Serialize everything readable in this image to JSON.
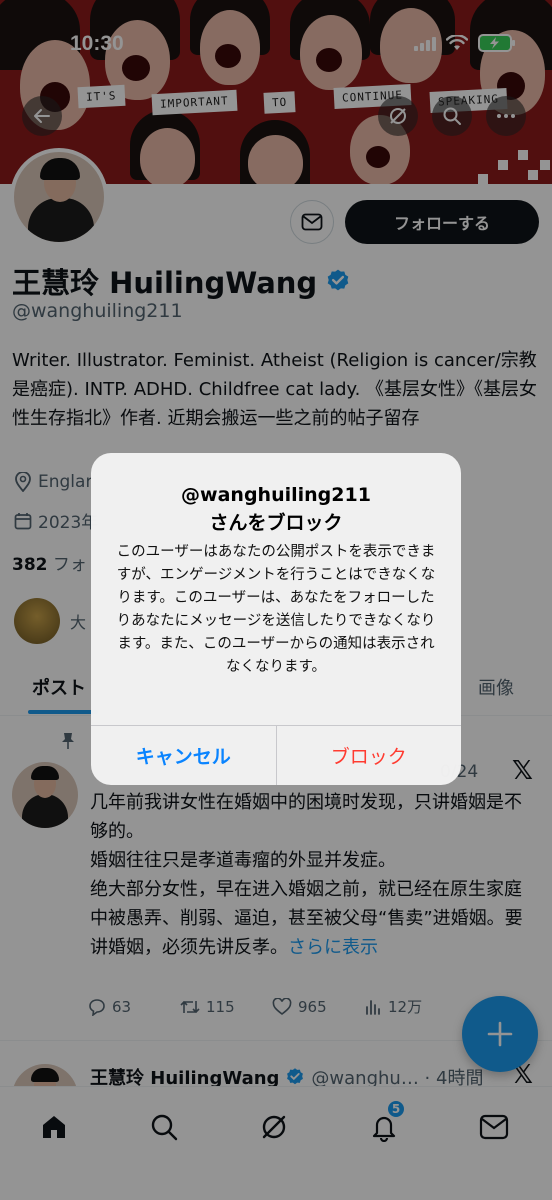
{
  "status_bar": {
    "time": "10:30"
  },
  "banner": {
    "speech_words": [
      "IT'S",
      "IMPORTANT",
      "TO",
      "CONTINUE",
      "SPEAKING"
    ]
  },
  "profile": {
    "display_name": "王慧玲 HuilingWang",
    "handle": "@wanghuiling211",
    "follow_label": "フォローする",
    "bio": "Writer. Illustrator. Feminist. Atheist (Religion is cancer/宗教是癌症). INTP. ADHD. Childfree cat lady. 《基层女性》《基层女性生存指北》作者. 近期会搬运一些之前的帖子留存",
    "location_partial": "Englar",
    "joined_partial": "2023年",
    "following_count": "382",
    "following_label_partial": "フォ",
    "followers_you_know_partial": "大"
  },
  "tabs": {
    "posts": "ポスト",
    "media": "画像"
  },
  "post1": {
    "date_partial": "0/24",
    "text_lines": [
      "几年前我讲女性在婚姻中的困境时发现，只讲婚姻是不够的。",
      "婚姻往往只是孝道毒瘤的外显并发症。",
      "绝大部分女性，早在进入婚姻之前，就已经在原生家庭中被愚弄、削弱、逼迫，甚至被父母“售卖”进婚姻。要讲婚姻，必须先讲反孝。"
    ],
    "show_more": "さらに表示",
    "metrics": {
      "replies": "63",
      "reposts": "115",
      "likes": "965",
      "views": "12万"
    }
  },
  "post2": {
    "name": "王慧玲 HuilingWang",
    "meta": "@wanghu… · 4時間"
  },
  "nav": {
    "notification_count": "5"
  },
  "dialog": {
    "title_line1": "@wanghuiling211",
    "title_line2": "さんをブロック",
    "message": "このユーザーはあなたの公開ポストを表示できますが、エンゲージメントを行うことはできなくなります。このユーザーは、あなたをフォローしたりあなたにメッセージを送信したりできなくなります。また、このユーザーからの通知は表示されなくなります。",
    "cancel_label": "キャンセル",
    "block_label": "ブロック"
  },
  "colors": {
    "accent": "#1d9bf0",
    "destructive": "#ff3b30",
    "ios_blue": "#0a84ff",
    "banner_red": "#8c1a1a"
  }
}
